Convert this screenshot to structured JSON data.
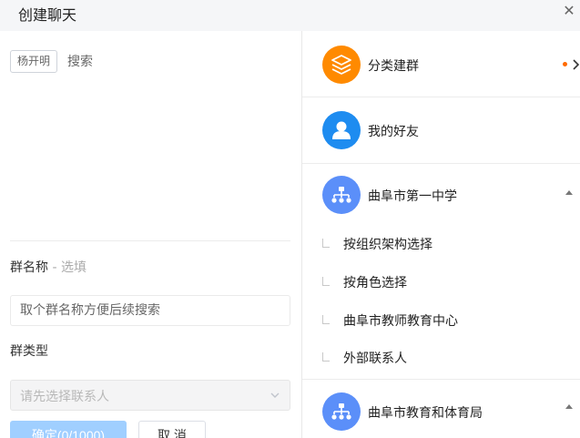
{
  "window": {
    "title": "创建聊天"
  },
  "left": {
    "selected_chip": "杨开明",
    "search_placeholder": "搜索",
    "group_name": {
      "label": "群名称",
      "optional": " - 选填",
      "placeholder": "取个群名称方便后续搜索"
    },
    "group_type": {
      "label": "群类型",
      "placeholder": "请先选择联系人"
    },
    "confirm_label": "确定(0/1000)",
    "cancel_label": "取 消"
  },
  "right": {
    "items": [
      {
        "label": "分类建群",
        "icon": "layers-icon",
        "color": "#ff8a00"
      },
      {
        "label": "我的好友",
        "icon": "user-icon",
        "color": "#1e8cf0"
      },
      {
        "label": "曲阜市第一中学",
        "icon": "org-chart-icon",
        "color": "#5b8ff9"
      },
      {
        "label": "曲阜市教育和体育局",
        "icon": "org-chart-icon",
        "color": "#5b8ff9"
      }
    ],
    "school_children": [
      "按组织架构选择",
      "按角色选择",
      "曲阜市教师教育中心",
      "外部联系人"
    ],
    "badge_color": "#ff6a00"
  }
}
